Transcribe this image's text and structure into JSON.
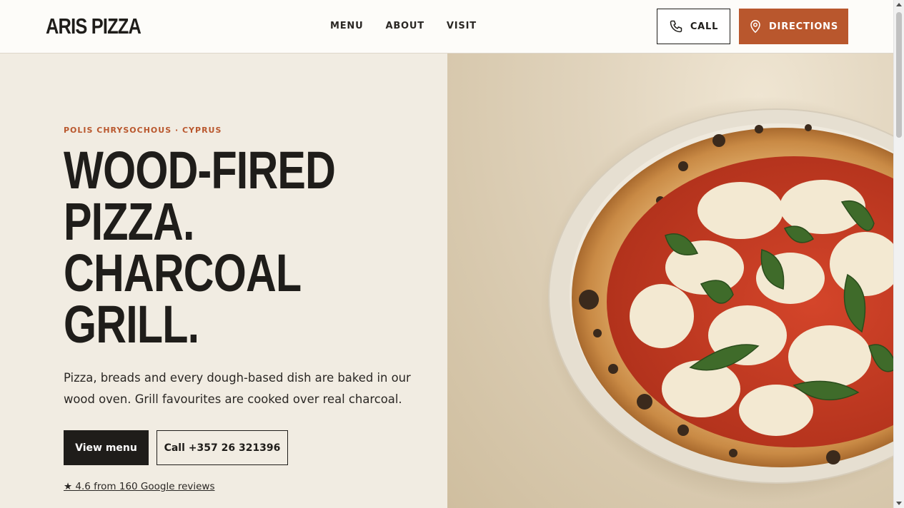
{
  "header": {
    "logo": "ARIS PIZZA",
    "nav": [
      {
        "label": "MENU"
      },
      {
        "label": "ABOUT"
      },
      {
        "label": "VISIT"
      }
    ],
    "call_label": "CALL",
    "directions_label": "DIRECTIONS"
  },
  "hero": {
    "eyebrow": "POLIS CHRYSOCHOUS · CYPRUS",
    "headline_lines": [
      "WOOD-FIRED",
      "PIZZA.",
      "CHARCOAL",
      "GRILL."
    ],
    "lede": "Pizza, breads and every dough-based dish are baked in our wood oven. Grill favourites are cooked over real charcoal.",
    "primary_button": "View menu",
    "secondary_button": "Call +357 26 321396",
    "reviews": "★ 4.6 from 160 Google reviews"
  },
  "colors": {
    "accent": "#b9572d",
    "ink": "#1f1d1a",
    "background": "#f1ece2"
  },
  "icons": {
    "call": "phone-icon",
    "directions": "map-pin-icon"
  }
}
